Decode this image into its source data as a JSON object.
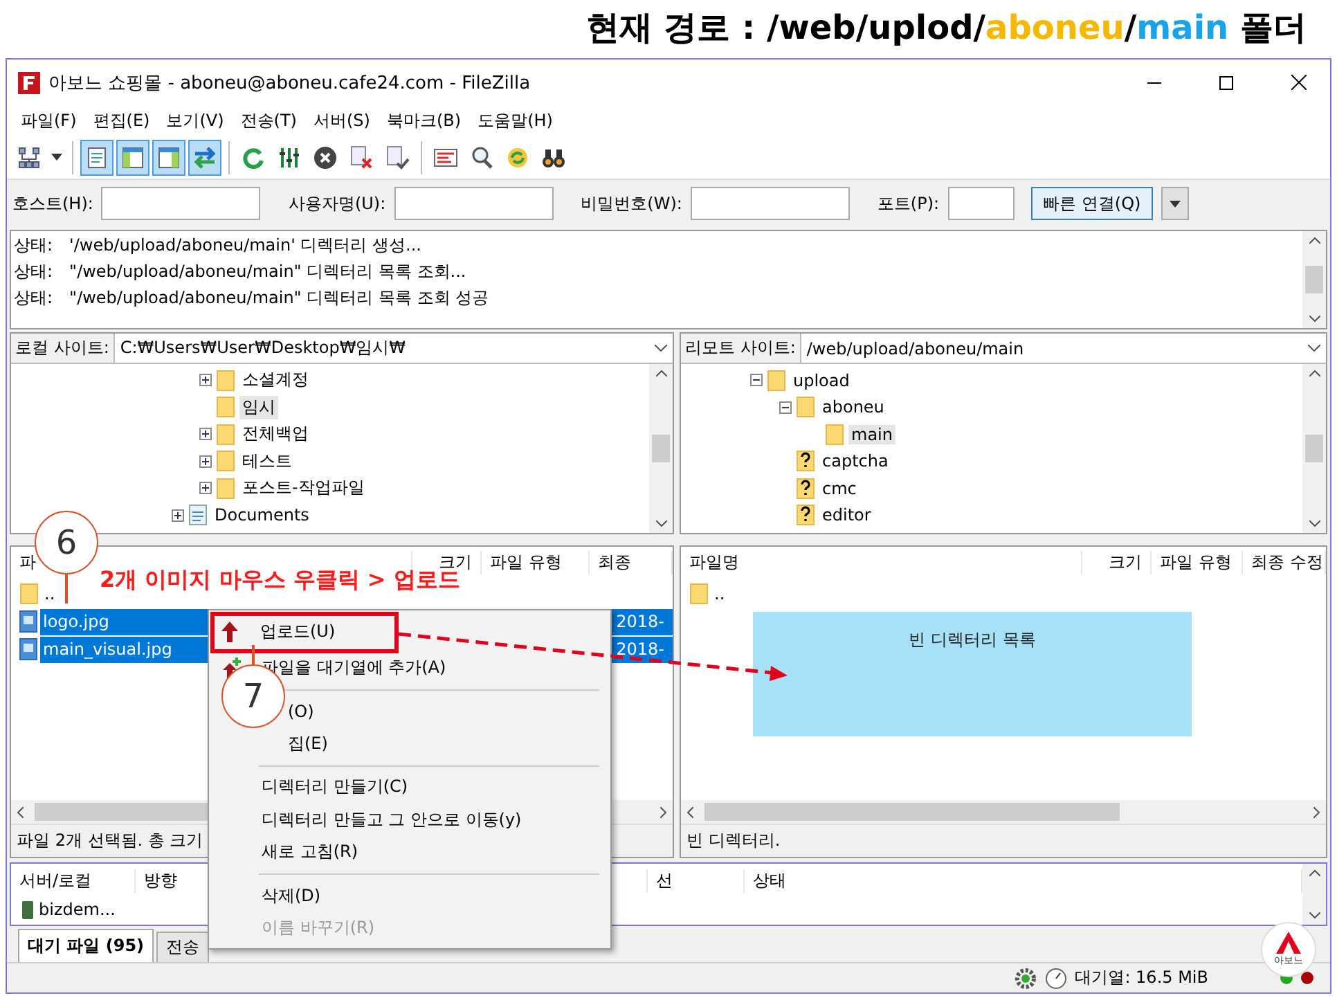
{
  "caption": {
    "parts": [
      {
        "text": "현재 경로 : /web/uplod/",
        "color": "#000000"
      },
      {
        "text": "aboneu",
        "color": "#f5b800"
      },
      {
        "text": "/",
        "color": "#000000"
      },
      {
        "text": "main",
        "color": "#1aa3e8"
      },
      {
        "text": " 폴더",
        "color": "#000000"
      }
    ]
  },
  "window": {
    "title": "아보느 쇼핑몰 - aboneu@aboneu.cafe24.com - FileZilla"
  },
  "menu": [
    "파일(F)",
    "편집(E)",
    "보기(V)",
    "전송(T)",
    "서버(S)",
    "북마크(B)",
    "도움말(H)"
  ],
  "toolbar": {
    "groups": [
      [
        {
          "kind": "site-manager",
          "pressed": false
        },
        {
          "kind": "caret",
          "pressed": false
        }
      ],
      [
        {
          "kind": "log",
          "pressed": true
        },
        {
          "kind": "local-tree",
          "pressed": true
        },
        {
          "kind": "remote-tree",
          "pressed": true
        },
        {
          "kind": "queue",
          "pressed": true
        }
      ],
      [
        {
          "kind": "refresh",
          "pressed": false
        },
        {
          "kind": "filter",
          "pressed": false
        },
        {
          "kind": "cancel",
          "pressed": false
        },
        {
          "kind": "disconnect",
          "pressed": false
        },
        {
          "kind": "reconnect",
          "pressed": false
        }
      ],
      [
        {
          "kind": "compare",
          "pressed": false
        },
        {
          "kind": "search",
          "pressed": false
        },
        {
          "kind": "sync",
          "pressed": false
        },
        {
          "kind": "binoculars",
          "pressed": false
        }
      ]
    ]
  },
  "quickconnect": {
    "fields": [
      {
        "label": "호스트(H):"
      },
      {
        "label": "사용자명(U):"
      },
      {
        "label": "비밀번호(W):"
      },
      {
        "label": "포트(P):"
      }
    ],
    "button": "빠른 연결(Q)"
  },
  "log": [
    {
      "label": "상태:",
      "message": "'/web/upload/aboneu/main' 디렉터리 생성..."
    },
    {
      "label": "상태:",
      "message": "\"/web/upload/aboneu/main\" 디렉터리 목록 조회..."
    },
    {
      "label": "상태:",
      "message": "\"/web/upload/aboneu/main\" 디렉터리 목록 조회 성공"
    }
  ],
  "local_site": {
    "label": "로컬 사이트:",
    "path": "C:₩Users₩User₩Desktop₩임시₩",
    "tree": [
      {
        "label": "소셜계정",
        "kind": "folder",
        "expandable": true,
        "selected": false
      },
      {
        "label": "임시",
        "kind": "folder",
        "expandable": false,
        "selected": true
      },
      {
        "label": "전체백업",
        "kind": "folder",
        "expandable": true,
        "selected": false
      },
      {
        "label": "테스트",
        "kind": "folder",
        "expandable": true,
        "selected": false
      },
      {
        "label": "포스트-작업파일",
        "kind": "folder",
        "expandable": true,
        "selected": false
      },
      {
        "label": "Documents",
        "kind": "library",
        "expandable": true,
        "selected": false
      }
    ]
  },
  "remote_site": {
    "label": "리모트 사이트:",
    "path": "/web/upload/aboneu/main",
    "tree": [
      {
        "label": "upload",
        "kind": "folder",
        "expanded": true,
        "selected": false,
        "children": [
          {
            "label": "aboneu",
            "kind": "folder",
            "expanded": true,
            "selected": false,
            "children": [
              {
                "label": "main",
                "kind": "folder",
                "selected": true
              }
            ]
          },
          {
            "label": "captcha",
            "kind": "unknown",
            "selected": false
          },
          {
            "label": "cmc",
            "kind": "unknown",
            "selected": false
          },
          {
            "label": "editor",
            "kind": "unknown",
            "selected": false
          }
        ]
      }
    ]
  },
  "local_files": {
    "columns": [
      "파",
      "크기",
      "파일 유형",
      "최종"
    ],
    "rows": [
      {
        "name": "..",
        "kind": "folder",
        "selected": false
      },
      {
        "name": "logo.jpg",
        "kind": "image",
        "selected": true,
        "modified": "2018-"
      },
      {
        "name": "main_visual.jpg",
        "kind": "image",
        "selected": true,
        "modified": "2018-"
      }
    ],
    "status": "파일 2개 선택됨. 총 크기"
  },
  "remote_files": {
    "columns": [
      "파일명",
      "크기",
      "파일 유형",
      "최종 수정"
    ],
    "rows": [
      {
        "name": "..",
        "kind": "folder",
        "selected": false
      }
    ],
    "status": "빈 디렉터리."
  },
  "queue": {
    "columns": [
      "서버/로컬",
      "방향",
      "선",
      "상태"
    ],
    "rows": [
      {
        "server": "bizdem..."
      }
    ]
  },
  "queue_tabs": [
    {
      "label": "대기 파일 (95)",
      "selected": true
    },
    {
      "label": "전송",
      "selected": false
    }
  ],
  "status_bar": {
    "queue": "대기열: 16.5 MiB"
  },
  "context_menu": [
    {
      "kind": "item",
      "label": "업로드(U)",
      "disabled": false
    },
    {
      "kind": "item",
      "label": "파일을 대기열에 추가(A)",
      "disabled": false
    },
    {
      "kind": "separator"
    },
    {
      "kind": "covered",
      "label": "(O)",
      "disabled": false
    },
    {
      "kind": "covered",
      "label": "집(E)",
      "disabled": false
    },
    {
      "kind": "separator"
    },
    {
      "kind": "item",
      "label": "디렉터리 만들기(C)",
      "disabled": false
    },
    {
      "kind": "item",
      "label": "디렉터리 만들고 그 안으로 이동(y)",
      "disabled": false
    },
    {
      "kind": "item",
      "label": "새로 고침(R)",
      "disabled": false
    },
    {
      "kind": "separator"
    },
    {
      "kind": "item",
      "label": "삭제(D)",
      "disabled": false
    },
    {
      "kind": "item",
      "label": "이름 바꾸기(R)",
      "disabled": true
    }
  ],
  "annotations": {
    "steps": [
      "6",
      "7"
    ],
    "callout": "2개 이미지 마우스 우클릭 > 업로드",
    "drop_note": "빈 디렉터리 목록",
    "logo": "아보느"
  }
}
